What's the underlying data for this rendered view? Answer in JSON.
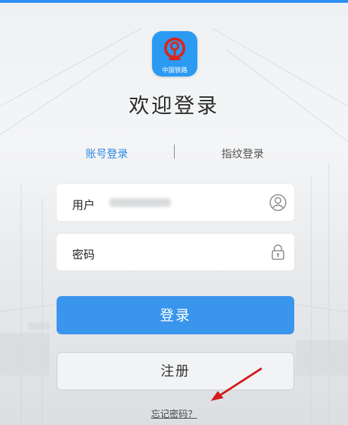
{
  "colors": {
    "accent": "#3a95ec",
    "tab_active": "#2b8ae3",
    "logo_bg": "#2b9af3",
    "arrow": "#d11b1b"
  },
  "logo": {
    "text": "中国铁路",
    "icon": "china-railway-logo-icon"
  },
  "title": "欢迎登录",
  "tabs": {
    "account": "账号登录",
    "fingerprint": "指纹登录"
  },
  "form": {
    "user_label": "用户",
    "password_label": "密码",
    "user_icon": "user-circle-icon",
    "password_icon": "lock-icon"
  },
  "buttons": {
    "login": "登录",
    "register": "注册"
  },
  "links": {
    "forgot_password": "忘记密码？"
  }
}
